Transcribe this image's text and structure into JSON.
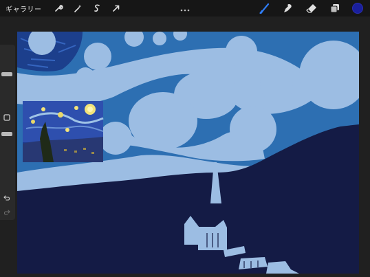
{
  "topbar": {
    "gallery_label": "ギャラリー",
    "left_tools": [
      "wrench-icon",
      "magic-wand-icon",
      "selection-s-icon",
      "transform-arrow-icon"
    ],
    "menu_icon": "three-dots-icon",
    "right_tools": [
      "brush-icon",
      "smudge-icon",
      "eraser-icon",
      "layers-icon"
    ],
    "current_color": "#1a1f9c",
    "active_tool_color": "#2f7df6"
  },
  "sidebar": {
    "controls": [
      "brush-size-slider",
      "modify-square-button",
      "opacity-slider",
      "undo-icon",
      "redo-icon"
    ]
  },
  "canvas": {
    "colors": {
      "sky_dark": "#2d6fb2",
      "swirl_light": "#9cbde3",
      "ground_navy": "#141b45"
    },
    "reference_image": "starry-night-reference"
  }
}
